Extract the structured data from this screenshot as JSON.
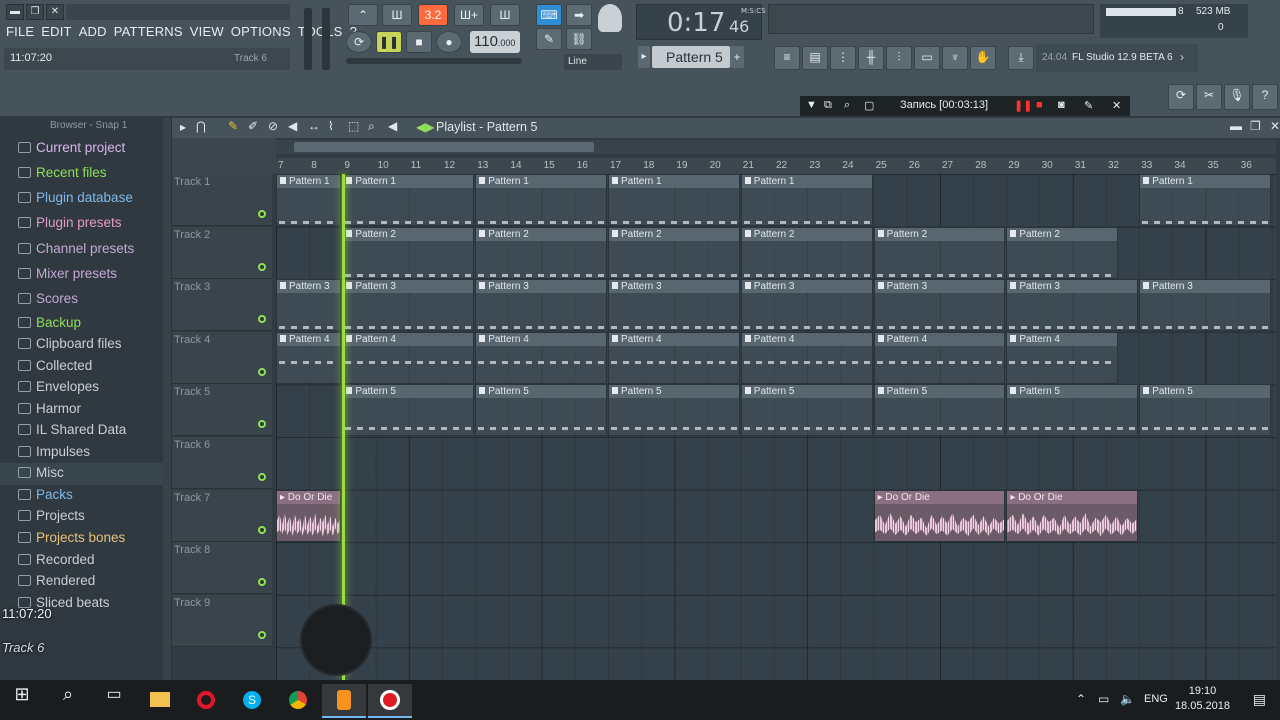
{
  "app": {
    "title": "FL Studio 12.9 BETA 6",
    "version_label": "24.04",
    "hint_text": "11:07:20",
    "hint_right": "Track 6"
  },
  "menu": [
    "FILE",
    "EDIT",
    "ADD",
    "PATTERNS",
    "VIEW",
    "OPTIONS",
    "TOOLS",
    "?"
  ],
  "transport": {
    "tempo": "110",
    "tempo_dec": ".000",
    "time": "0:17",
    "time_sub": "46",
    "time_mode": "M:S:CS",
    "pattern": "Pattern 5",
    "snap_mode": "Line",
    "meter": "3.2"
  },
  "cpu": {
    "mem": "523 MB",
    "voices": "8",
    "cpu": "0"
  },
  "record_bar": {
    "label": "Запись [00:03:13]"
  },
  "browser": {
    "header": "Browser - Snap 1",
    "items": [
      "Current project",
      "Recent files",
      "Plugin database",
      "Plugin presets",
      "Channel presets",
      "Mixer presets",
      "Scores",
      "Backup",
      "Clipboard files",
      "Collected",
      "Envelopes",
      "Harmor",
      "IL Shared Data",
      "Impulses",
      "Misc",
      "Packs",
      "Projects",
      "Projects bones",
      "Recorded",
      "Rendered",
      "Sliced beats"
    ],
    "selected": "Misc"
  },
  "playlist": {
    "title": "Playlist - Pattern 5",
    "ruler": [
      "7",
      "8",
      "9",
      "10",
      "11",
      "12",
      "13",
      "14",
      "15",
      "16",
      "17",
      "18",
      "19",
      "20",
      "21",
      "22",
      "23",
      "24",
      "25",
      "26",
      "27",
      "28",
      "29",
      "30",
      "31",
      "32",
      "33",
      "34",
      "35",
      "36"
    ],
    "tracks": [
      "Track 1",
      "Track 2",
      "Track 3",
      "Track 4",
      "Track 5",
      "Track 6",
      "Track 7",
      "Track 8",
      "Track 9"
    ],
    "pattern_clips": [
      {
        "track": 0,
        "name": "Pattern 1",
        "start": 7,
        "len": 2
      },
      {
        "track": 0,
        "name": "Pattern 1",
        "start": 9,
        "len": 4
      },
      {
        "track": 0,
        "name": "Pattern 1",
        "start": 13,
        "len": 4
      },
      {
        "track": 0,
        "name": "Pattern 1",
        "start": 17,
        "len": 4
      },
      {
        "track": 0,
        "name": "Pattern 1",
        "start": 21,
        "len": 4
      },
      {
        "track": 0,
        "name": "Pattern 1",
        "start": 33,
        "len": 4
      },
      {
        "track": 1,
        "name": "Pattern 2",
        "start": 9,
        "len": 4
      },
      {
        "track": 1,
        "name": "Pattern 2",
        "start": 13,
        "len": 4
      },
      {
        "track": 1,
        "name": "Pattern 2",
        "start": 17,
        "len": 4
      },
      {
        "track": 1,
        "name": "Pattern 2",
        "start": 21,
        "len": 4
      },
      {
        "track": 1,
        "name": "Pattern 2",
        "start": 25,
        "len": 4
      },
      {
        "track": 1,
        "name": "Pattern 2",
        "start": 29,
        "len": 3.4
      },
      {
        "track": 2,
        "name": "Pattern 3",
        "start": 7,
        "len": 2
      },
      {
        "track": 2,
        "name": "Pattern 3",
        "start": 9,
        "len": 4
      },
      {
        "track": 2,
        "name": "Pattern 3",
        "start": 13,
        "len": 4
      },
      {
        "track": 2,
        "name": "Pattern 3",
        "start": 17,
        "len": 4
      },
      {
        "track": 2,
        "name": "Pattern 3",
        "start": 21,
        "len": 4
      },
      {
        "track": 2,
        "name": "Pattern 3",
        "start": 25,
        "len": 4
      },
      {
        "track": 2,
        "name": "Pattern 3",
        "start": 29,
        "len": 4
      },
      {
        "track": 2,
        "name": "Pattern 3",
        "start": 33,
        "len": 4
      },
      {
        "track": 3,
        "name": "Pattern 4",
        "start": 7,
        "len": 2
      },
      {
        "track": 3,
        "name": "Pattern 4",
        "start": 9,
        "len": 4
      },
      {
        "track": 3,
        "name": "Pattern 4",
        "start": 13,
        "len": 4
      },
      {
        "track": 3,
        "name": "Pattern 4",
        "start": 17,
        "len": 4
      },
      {
        "track": 3,
        "name": "Pattern 4",
        "start": 21,
        "len": 4
      },
      {
        "track": 3,
        "name": "Pattern 4",
        "start": 25,
        "len": 4
      },
      {
        "track": 3,
        "name": "Pattern 4",
        "start": 29,
        "len": 3.4
      },
      {
        "track": 4,
        "name": "Pattern 5",
        "start": 9,
        "len": 4
      },
      {
        "track": 4,
        "name": "Pattern 5",
        "start": 13,
        "len": 4
      },
      {
        "track": 4,
        "name": "Pattern 5",
        "start": 17,
        "len": 4
      },
      {
        "track": 4,
        "name": "Pattern 5",
        "start": 21,
        "len": 4
      },
      {
        "track": 4,
        "name": "Pattern 5",
        "start": 25,
        "len": 4
      },
      {
        "track": 4,
        "name": "Pattern 5",
        "start": 29,
        "len": 4
      },
      {
        "track": 4,
        "name": "Pattern 5",
        "start": 33,
        "len": 4
      }
    ],
    "audio_clips": [
      {
        "track": 6,
        "name": "Do Or Die",
        "start": 7,
        "len": 2
      },
      {
        "track": 6,
        "name": "Do Or Die",
        "start": 25,
        "len": 4
      },
      {
        "track": 6,
        "name": "Do Or Die",
        "start": 29,
        "len": 4
      }
    ],
    "playhead_bar": 9
  },
  "overlay": {
    "time": "11:07:20",
    "track": "Track 6"
  },
  "taskbar": {
    "time": "19:10",
    "date": "18.05.2018",
    "lang": "ENG"
  }
}
